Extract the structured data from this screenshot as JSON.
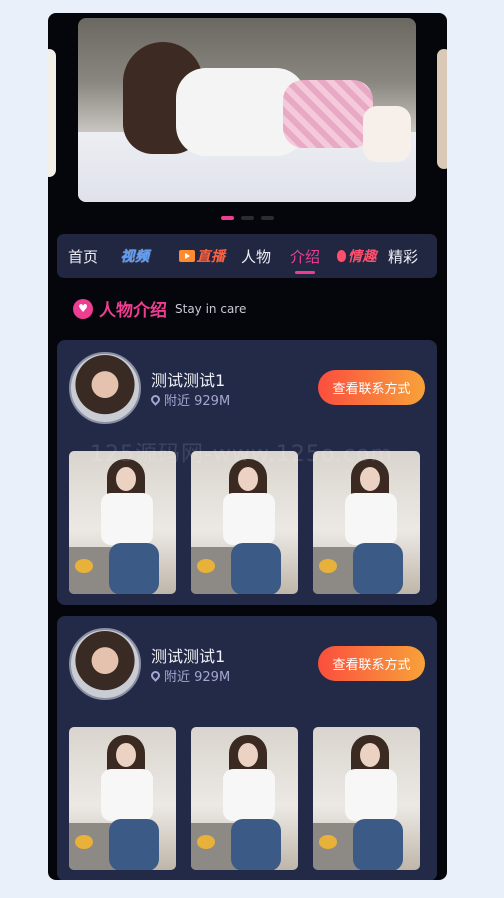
{
  "carousel": {
    "dot_count": 3,
    "active_index": 0
  },
  "nav": {
    "items": [
      {
        "label": "首页",
        "type": "text"
      },
      {
        "label": "视频",
        "type": "badge-video"
      },
      {
        "label": "直播",
        "type": "badge-live"
      },
      {
        "label": "人物",
        "type": "text"
      },
      {
        "label": "介绍",
        "type": "text",
        "active": true
      },
      {
        "label": "情趣",
        "type": "badge-qq"
      },
      {
        "label": "精彩",
        "type": "text"
      }
    ]
  },
  "section": {
    "title": "人物介绍",
    "subtitle": "Stay in care",
    "icon": "heart-icon"
  },
  "cards": [
    {
      "name": "测试测试1",
      "location": "附近 929M",
      "button": "查看联系方式"
    },
    {
      "name": "测试测试1",
      "location": "附近 929M",
      "button": "查看联系方式"
    }
  ],
  "watermark": "125源码网-www.125o.com",
  "colors": {
    "accent": "#ef3d92",
    "card_bg": "#232a48",
    "page_bg": "#e9f0f9",
    "button_start": "#fb4e3e",
    "button_end": "#f7a23a"
  }
}
